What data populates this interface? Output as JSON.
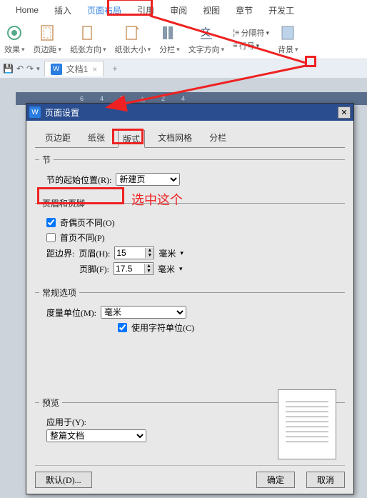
{
  "ribbon": {
    "tabs": [
      "Home",
      "插入",
      "页面布局",
      "引用",
      "审阅",
      "视图",
      "章节",
      "开发工"
    ],
    "active_index": 2,
    "groups": {
      "effects": "效果",
      "margins": "页边距",
      "orientation": "纸张方向",
      "size": "纸张大小",
      "columns": "分栏",
      "textdir": "文字方向",
      "linenum": "行号",
      "separator": "分隔符",
      "background": "背景"
    }
  },
  "doctab": {
    "name": "文档1",
    "plus": "+"
  },
  "ruler_marks": [
    "6",
    "4",
    "2",
    "",
    "2",
    "4"
  ],
  "dialog": {
    "title": "页面设置",
    "tabs": [
      "页边距",
      "纸张",
      "版式",
      "文档网格",
      "分栏"
    ],
    "active": 2,
    "section": {
      "legend": "节",
      "start_label": "节的起始位置(R):",
      "start_value": "新建页"
    },
    "headerfooter": {
      "legend": "页眉和页脚",
      "oddeven": "奇偶页不同(O)",
      "firstpage": "首页不同(P)",
      "fromedge": "距边界:",
      "header_label": "页眉(H):",
      "header_value": "15",
      "header_unit": "毫米",
      "footer_label": "页脚(F):",
      "footer_value": "17.5",
      "footer_unit": "毫米"
    },
    "general": {
      "legend": "常规选项",
      "unit_label": "度量单位(M):",
      "unit_value": "毫米",
      "usechar": "使用字符单位(C)"
    },
    "preview": {
      "legend": "预览",
      "apply_label": "应用于(Y):",
      "apply_value": "整篇文档"
    },
    "buttons": {
      "default": "默认(D)...",
      "ok": "确定",
      "cancel": "取消"
    }
  },
  "annotation": "选中这个"
}
